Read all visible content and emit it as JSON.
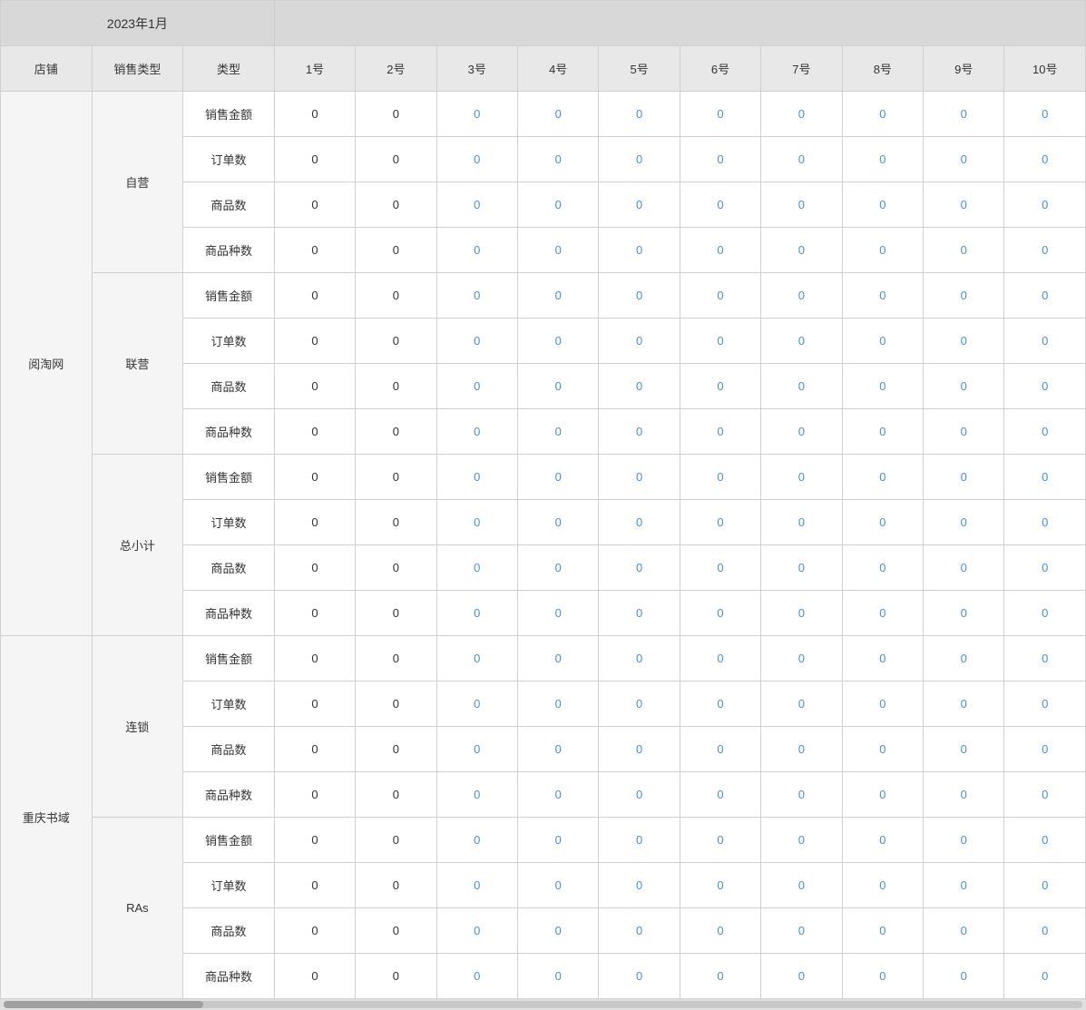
{
  "title": "2023年1月",
  "headers": {
    "store": "店铺",
    "saletype": "销售类型",
    "type": "类型",
    "days": [
      "1号",
      "2号",
      "3号",
      "4号",
      "5号",
      "6号",
      "7号",
      "8号",
      "9号",
      "10号"
    ]
  },
  "rows": [
    {
      "store": "阅淘网",
      "storespanrows": 16,
      "groups": [
        {
          "saletype": "自营",
          "saletypespanrows": 4,
          "items": [
            {
              "type": "销售金额",
              "values": [
                0,
                0,
                0,
                0,
                0,
                0,
                0,
                0,
                0,
                0
              ]
            },
            {
              "type": "订单数",
              "values": [
                0,
                0,
                0,
                0,
                0,
                0,
                0,
                0,
                0,
                0
              ]
            },
            {
              "type": "商品数",
              "values": [
                0,
                0,
                0,
                0,
                0,
                0,
                0,
                0,
                0,
                0
              ]
            },
            {
              "type": "商品种数",
              "values": [
                0,
                0,
                0,
                0,
                0,
                0,
                0,
                0,
                0,
                0
              ]
            }
          ]
        },
        {
          "saletype": "联营",
          "saletypespanrows": 4,
          "items": [
            {
              "type": "销售金额",
              "values": [
                0,
                0,
                0,
                0,
                0,
                0,
                0,
                0,
                0,
                0
              ]
            },
            {
              "type": "订单数",
              "values": [
                0,
                0,
                0,
                0,
                0,
                0,
                0,
                0,
                0,
                0
              ]
            },
            {
              "type": "商品数",
              "values": [
                0,
                0,
                0,
                0,
                0,
                0,
                0,
                0,
                0,
                0
              ]
            },
            {
              "type": "商品种数",
              "values": [
                0,
                0,
                0,
                0,
                0,
                0,
                0,
                0,
                0,
                0
              ]
            }
          ]
        },
        {
          "saletype": "总小计",
          "saletypespanrows": 4,
          "items": [
            {
              "type": "销售金额",
              "values": [
                0,
                0,
                0,
                0,
                0,
                0,
                0,
                0,
                0,
                0
              ]
            },
            {
              "type": "订单数",
              "values": [
                0,
                0,
                0,
                0,
                0,
                0,
                0,
                0,
                0,
                0
              ]
            },
            {
              "type": "商品数",
              "values": [
                0,
                0,
                0,
                0,
                0,
                0,
                0,
                0,
                0,
                0
              ]
            },
            {
              "type": "商品种数",
              "values": [
                0,
                0,
                0,
                0,
                0,
                0,
                0,
                0,
                0,
                0
              ]
            }
          ]
        }
      ]
    },
    {
      "store": "重庆书域",
      "storespanrows": 8,
      "groups": [
        {
          "saletype": "连锁",
          "saletypespanrows": 4,
          "items": [
            {
              "type": "销售金额",
              "values": [
                0,
                0,
                0,
                0,
                0,
                0,
                0,
                0,
                0,
                0
              ]
            },
            {
              "type": "订单数",
              "values": [
                0,
                0,
                0,
                0,
                0,
                0,
                0,
                0,
                0,
                0
              ]
            },
            {
              "type": "商品数",
              "values": [
                0,
                0,
                0,
                0,
                0,
                0,
                0,
                0,
                0,
                0
              ]
            },
            {
              "type": "商品种数",
              "values": [
                0,
                0,
                0,
                0,
                0,
                0,
                0,
                0,
                0,
                0
              ]
            }
          ]
        },
        {
          "saletype": "RAs",
          "saletypespanrows": 4,
          "items": [
            {
              "type": "销售金额",
              "values": [
                0,
                0,
                0,
                0,
                0,
                0,
                0,
                0,
                0,
                0
              ]
            },
            {
              "type": "订单数",
              "values": [
                0,
                0,
                0,
                0,
                0,
                0,
                0,
                0,
                0,
                0
              ]
            },
            {
              "type": "商品数",
              "values": [
                0,
                0,
                0,
                0,
                0,
                0,
                0,
                0,
                0,
                0
              ]
            },
            {
              "type": "商品种数",
              "values": [
                0,
                0,
                0,
                0,
                0,
                0,
                0,
                0,
                0,
                0
              ]
            }
          ]
        }
      ]
    }
  ]
}
